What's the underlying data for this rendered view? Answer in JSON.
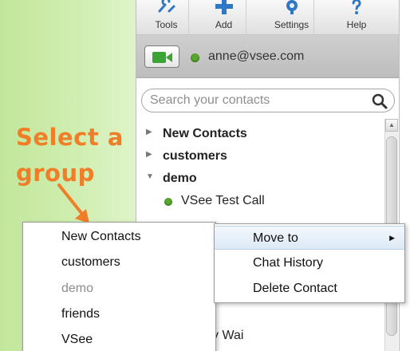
{
  "callout": {
    "line1": "Select a",
    "line2": "group"
  },
  "toolbar": {
    "items": [
      {
        "label": "Tools",
        "icon": "tools-icon"
      },
      {
        "label": "Add",
        "icon": "add-icon"
      },
      {
        "label": "Settings",
        "icon": "settings-icon"
      },
      {
        "label": "Help",
        "icon": "help-icon"
      }
    ]
  },
  "user": {
    "email": "anne@vsee.com",
    "status_color": "#5aa72f"
  },
  "search": {
    "placeholder": "Search your contacts",
    "value": ""
  },
  "contacts": {
    "groups": [
      {
        "name": "New Contacts",
        "expanded": false
      },
      {
        "name": "customers",
        "expanded": false
      },
      {
        "name": "demo",
        "expanded": true
      }
    ],
    "demo_contacts": [
      {
        "name": "VSee Test Call"
      }
    ],
    "partial_contact": "y Wai"
  },
  "group_menu": {
    "items": [
      {
        "label": "New Contacts",
        "enabled": true
      },
      {
        "label": "customers",
        "enabled": true
      },
      {
        "label": "demo",
        "enabled": false
      },
      {
        "label": "friends",
        "enabled": true
      },
      {
        "label": "VSee",
        "enabled": true
      }
    ]
  },
  "context_menu": {
    "items": [
      {
        "label": "Move to",
        "submenu": true,
        "active": true
      },
      {
        "label": "Chat History",
        "submenu": false,
        "active": false
      },
      {
        "label": "Delete Contact",
        "submenu": false,
        "active": false
      }
    ]
  },
  "colors": {
    "accent": "#f07d27",
    "online": "#5aa72f",
    "backdrop": "#cfeeb0"
  }
}
